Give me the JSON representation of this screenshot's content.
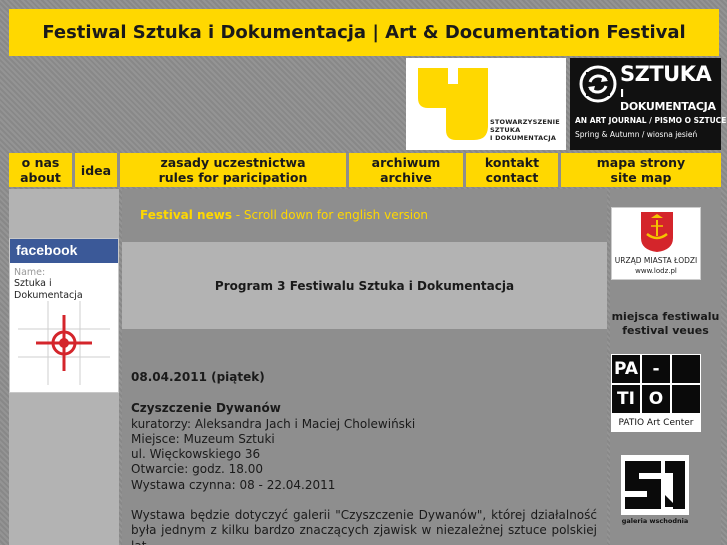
{
  "header": {
    "title": "Festiwal Sztuka i Dokumentacja | Art & Documentation Festival"
  },
  "logos": {
    "stowarzyszenie": [
      "STOWARZYSZENIE",
      "SZTUKA",
      "I DOKUMENTACJA"
    ],
    "journal": {
      "title_line1": "SZTUKA",
      "title_line2": "I DOKUMENTACJA",
      "tagline": "AN ART JOURNAL / PISMO O SZTUCE",
      "seasons": "Spring & Autumn  /  wiosna jesień"
    }
  },
  "nav": [
    {
      "line1": "o nas",
      "line2": "about"
    },
    {
      "line1": "idea",
      "line2": ""
    },
    {
      "line1": "zasady uczestnictwa",
      "line2": "rules for paricipation"
    },
    {
      "line1": "archiwum",
      "line2": "archive"
    },
    {
      "line1": "kontakt",
      "line2": "contact"
    },
    {
      "line1": "mapa strony",
      "line2": "site map"
    }
  ],
  "facebook": {
    "header": "facebook",
    "name_label": "Name:",
    "name_line1": "Sztuka i",
    "name_line2": "Dokumentacja"
  },
  "news": {
    "label": "Festival news",
    "suffix": " - Scroll down for english version"
  },
  "program": {
    "title": "Program 3 Festiwalu Sztuka i Dokumentacja"
  },
  "article": {
    "date": "08.04.2011 (piątek)",
    "event_title": "Czyszczenie Dywanów",
    "lines": [
      "kuratorzy: Aleksandra Jach i Maciej Cholewiński",
      "Miejsce: Muzeum Sztuki",
      "ul. Więckowskiego 36",
      "Otwarcie: godz. 18.00",
      "Wystawa czynna: 08 - 22.04.2011"
    ],
    "paragraph": "Wystawa będzie dotyczyć galerii \"Czyszczenie Dywanów\", której działalność była jednym z kilku bardzo znaczących zjawisk w niezależnej sztuce polskiej lat"
  },
  "sidebar_right": {
    "lodz_caption1": "URZĄD MIASTA ŁODZI",
    "lodz_caption2": "www.lodz.pl",
    "venues_line1": "miejsca festiwalu",
    "venues_line2": "festival veues",
    "patio_letters": [
      "PA",
      "-",
      "",
      "TI",
      "O",
      ""
    ],
    "patio_caption": "PATIO Art Center",
    "galeria_caption": "galeria wschodnia"
  },
  "colors": {
    "accent_yellow": "#ffd800",
    "background_gray": "#8e8e8e",
    "panel_gray": "#b3b3b3",
    "facebook_blue": "#3b5998"
  }
}
